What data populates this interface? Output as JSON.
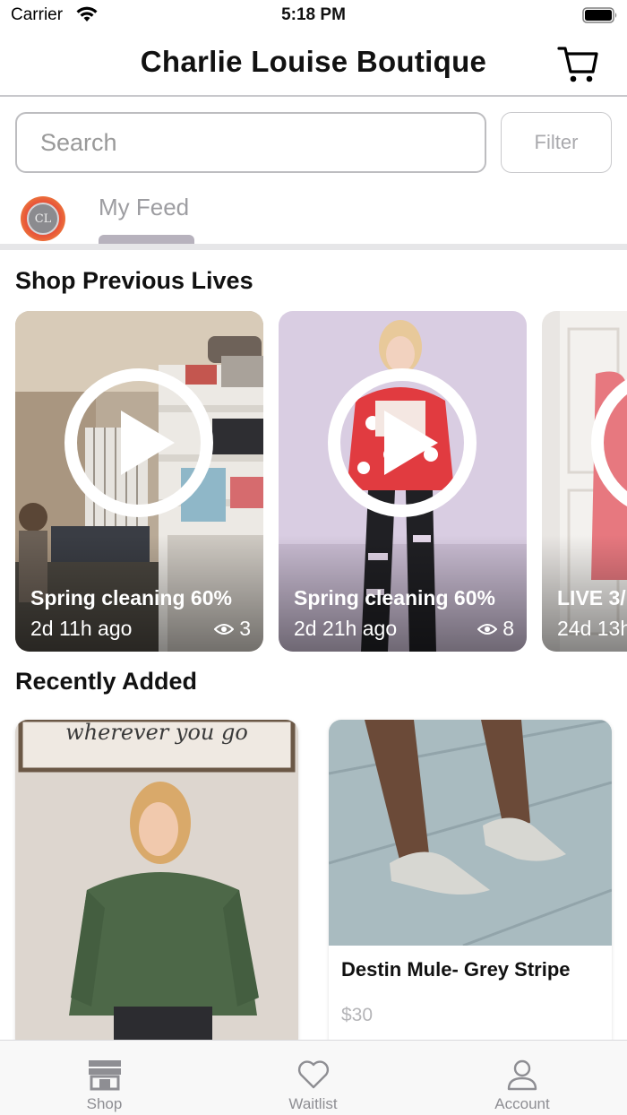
{
  "status_bar": {
    "carrier": "Carrier",
    "time": "5:18 PM"
  },
  "header": {
    "title": "Charlie Louise Boutique",
    "cart_icon": "cart-icon"
  },
  "search": {
    "placeholder": "Search",
    "filter_label": "Filter"
  },
  "feed_tabs": {
    "avatar_monogram": "CL",
    "active_tab": "My Feed"
  },
  "previous_lives": {
    "title": "Shop Previous Lives",
    "items": [
      {
        "title": "Spring cleaning 60%",
        "time": "2d 11h ago",
        "views": "3"
      },
      {
        "title": "Spring cleaning 60%",
        "time": "2d 21h ago",
        "views": "8"
      },
      {
        "title": "LIVE 3/",
        "time": "24d 13h",
        "views": ""
      }
    ]
  },
  "recently_added": {
    "title": "Recently Added",
    "sign_text": "wherever you go",
    "items": [
      {
        "name": "",
        "price": ""
      },
      {
        "name": "Destin Mule- Grey Stripe",
        "price": "$30"
      }
    ]
  },
  "tab_bar": {
    "items": [
      {
        "label": "Shop",
        "icon": "shop-icon"
      },
      {
        "label": "Waitlist",
        "icon": "heart-icon"
      },
      {
        "label": "Account",
        "icon": "person-icon"
      }
    ]
  },
  "colors": {
    "accent_tab": "#b7b2bd",
    "avatar_ring": "#e8563a",
    "inactive": "#8e8e93"
  }
}
